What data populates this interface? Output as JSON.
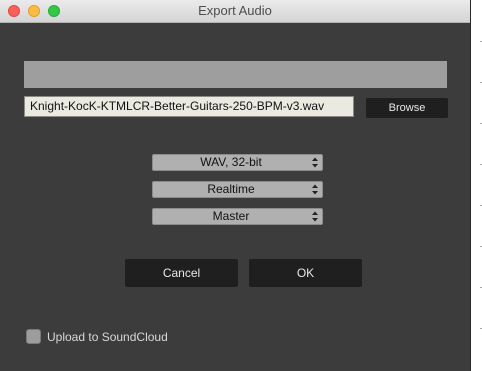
{
  "window": {
    "title": "Export Audio"
  },
  "export": {
    "file_path": "Knight-KocK-KTMLCR-Better-Guitars-250-BPM-v3.wav",
    "browse_label": "Browse",
    "format": {
      "selected": "WAV, 32-bit"
    },
    "mode": {
      "selected": "Realtime"
    },
    "source": {
      "selected": "Master"
    },
    "cancel_label": "Cancel",
    "ok_label": "OK",
    "upload": {
      "label": "Upload to SoundCloud",
      "checked": false
    }
  },
  "icons": {
    "traffic_lights": [
      "close-icon",
      "minimize-icon",
      "zoom-icon"
    ],
    "select_arrows": "up-down-arrows-icon"
  },
  "colors": {
    "window_bg": "#3c3c3c",
    "button_bg": "#1f1f1f",
    "select_bg": "#b0b0b0",
    "close": "#fc605c",
    "minimize": "#fdbc40",
    "zoom": "#34c84a"
  }
}
